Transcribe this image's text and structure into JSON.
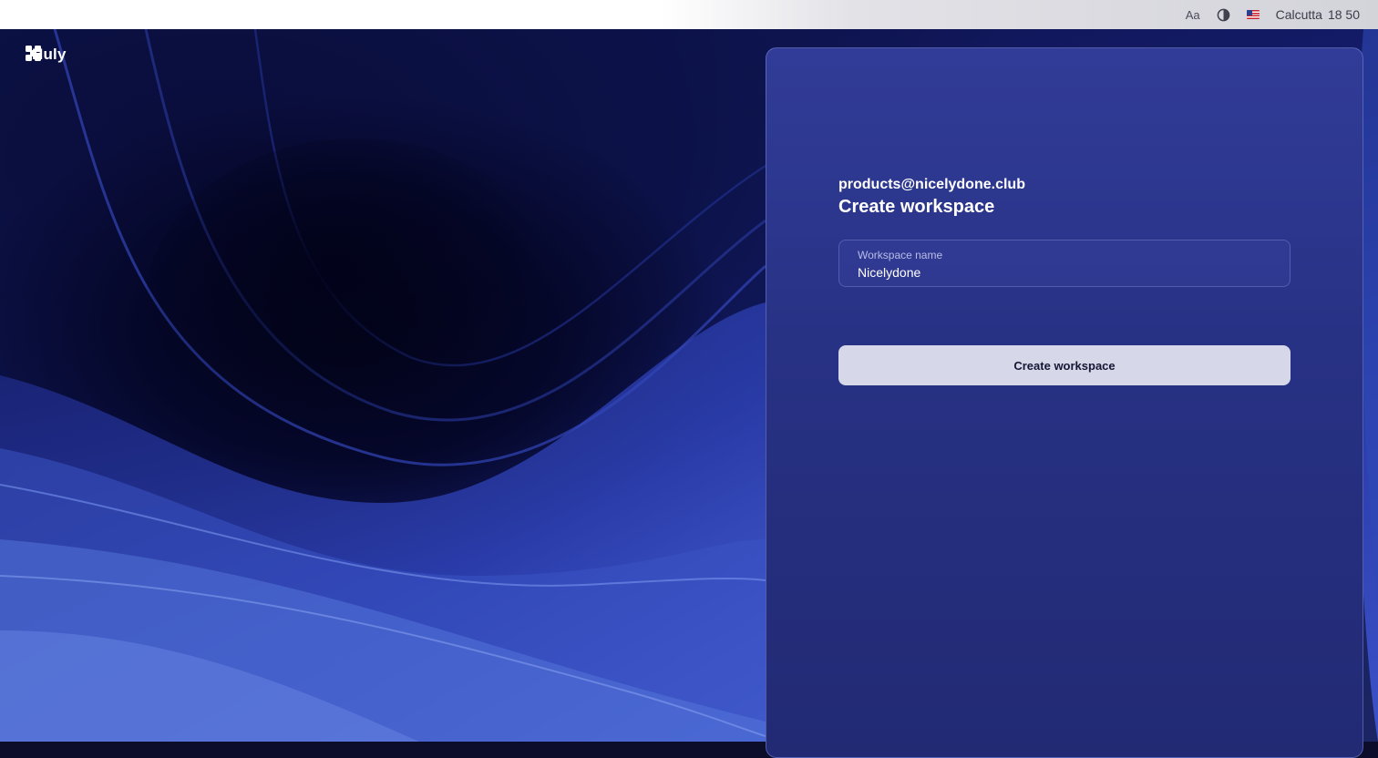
{
  "topbar": {
    "font_size_label": "Aa",
    "theme_icon": "contrast-icon",
    "language_icon": "us-flag-icon",
    "city": "Calcutta",
    "time": "18 50"
  },
  "brand": {
    "icon": "huly-logo-icon",
    "name": "Huly"
  },
  "form": {
    "email": "products@nicelydone.club",
    "title": "Create workspace",
    "workspace_field": {
      "label": "Workspace name",
      "value": "Nicelydone"
    },
    "submit_label": "Create workspace"
  },
  "colors": {
    "panel": "#2b3388",
    "button": "#d6d7e9",
    "button_text": "#141734",
    "background_accent": "#3b52c8"
  }
}
